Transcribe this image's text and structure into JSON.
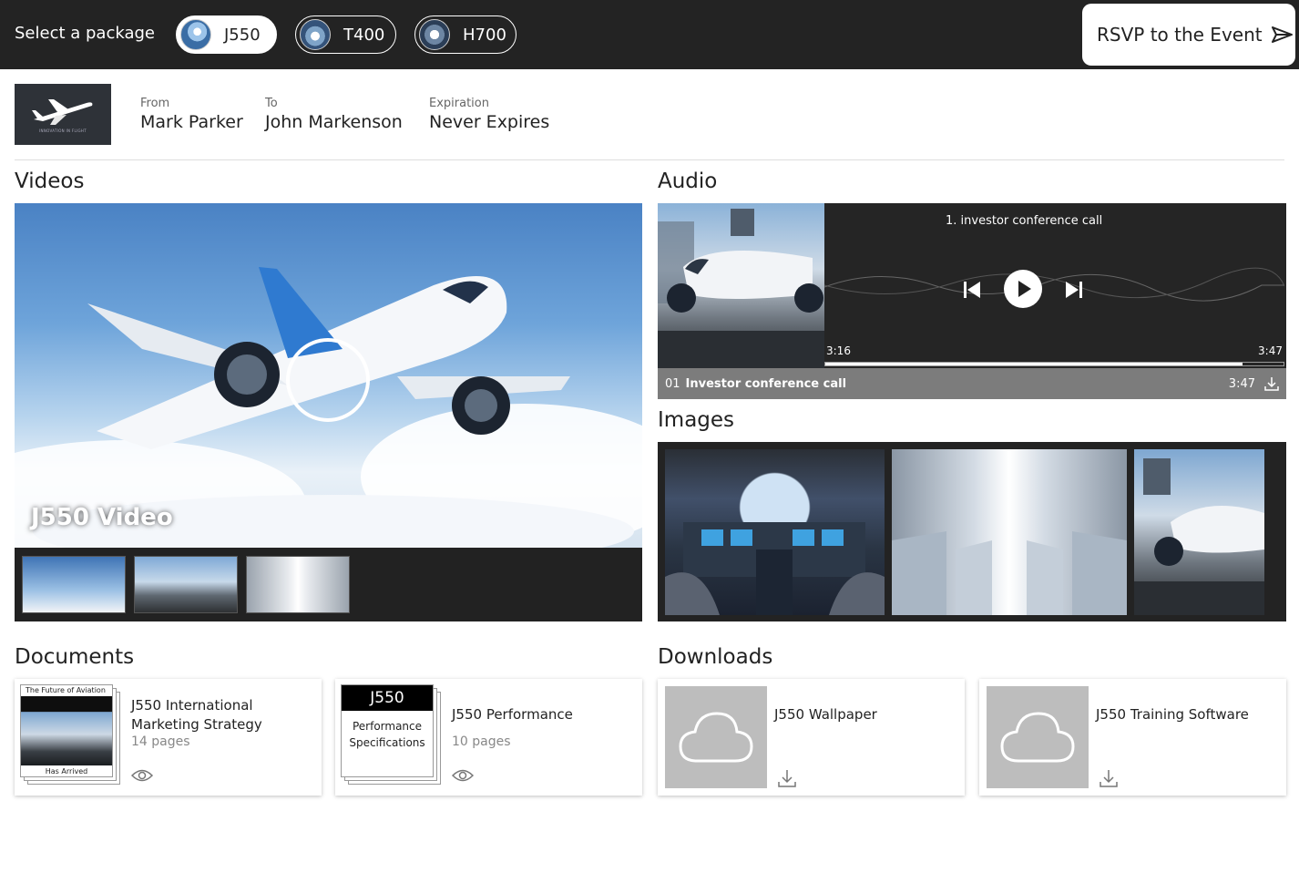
{
  "topbar": {
    "select_label": "Select a package",
    "packages": [
      {
        "label": "J550",
        "active": true
      },
      {
        "label": "T400",
        "active": false
      },
      {
        "label": "H700",
        "active": false
      }
    ],
    "rsvp_label": "RSVP to the Event"
  },
  "header": {
    "logo_caption": "INNOVATION IN FLIGHT",
    "from_label": "From",
    "from_value": "Mark Parker",
    "to_label": "To",
    "to_value": "John Markenson",
    "expiration_label": "Expiration",
    "expiration_value": "Never Expires"
  },
  "sections": {
    "videos": "Videos",
    "audio": "Audio",
    "images": "Images",
    "documents": "Documents",
    "downloads": "Downloads"
  },
  "video": {
    "title": "J550 Video",
    "thumbnail_count": 3
  },
  "audio": {
    "now_playing": "1. investor conference call",
    "current_time": "3:16",
    "total_time": "3:47",
    "progress": 0.91,
    "tracks": [
      {
        "number": "01",
        "name": "Investor conference call",
        "duration": "3:47"
      }
    ]
  },
  "documents": [
    {
      "title": "J550  International Marketing Strategy",
      "pages": "14 pages",
      "cover_header": "The Future of Aviation",
      "cover_footer": "Has Arrived"
    },
    {
      "title": "J550 Performance",
      "pages": "10 pages",
      "cover_header": "J550",
      "cover_body_line1": "Performance",
      "cover_body_line2": "Specifications"
    }
  ],
  "downloads": [
    {
      "title": "J550 Wallpaper"
    },
    {
      "title": "J550 Training Software"
    }
  ],
  "colors": {
    "topbar_bg": "#232323",
    "panel_bg": "#232323",
    "track_row_bg": "#7c7c7c",
    "download_thumb_bg": "#bdbdbd"
  }
}
